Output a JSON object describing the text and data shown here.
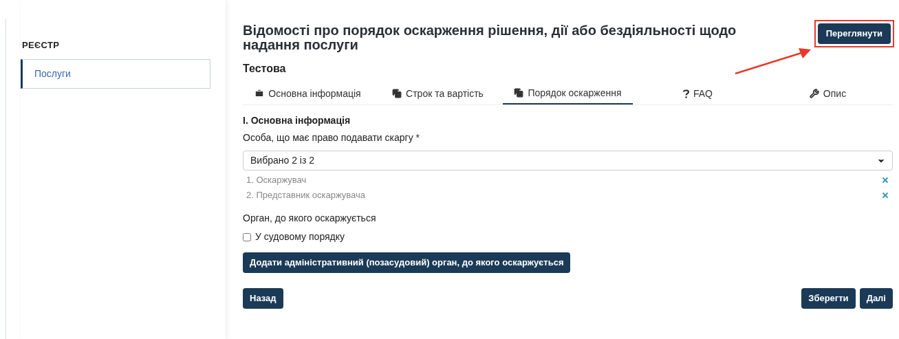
{
  "sidebar": {
    "heading": "РЕЄСТР",
    "items": [
      {
        "label": "Послуги",
        "selected": true
      }
    ]
  },
  "page": {
    "title": "Відомості про порядок оскарження рішення, дії або бездіяльності щодо надання послуги",
    "subtitle": "Тестова",
    "preview_button": "Переглянути",
    "preview_highlighted": true
  },
  "tabs": [
    {
      "label": "Основна інформація",
      "kind": "general",
      "selected": false
    },
    {
      "label": "Строк та вартість",
      "kind": "terms",
      "selected": false
    },
    {
      "label": "Порядок оскарження",
      "kind": "appeal",
      "selected": true
    },
    {
      "label": "FAQ",
      "kind": "faq",
      "selected": false
    },
    {
      "label": "Опис",
      "kind": "description",
      "selected": false
    }
  ],
  "form": {
    "section_title": "I. Основна інформація",
    "complainant_label": "Особа, що має право подавати скаргу *",
    "select_value": "Вибрано 2 із 2",
    "selected_items": [
      "1. Оскаржувач",
      "2. Представник оскаржувача"
    ],
    "authority_label": "Орган, до якого оскаржується",
    "court_checkbox": {
      "label": "У судовому порядку",
      "checked": false
    },
    "add_button": "Додати адміністративний (позасудовий) орган, до якого оскаржується"
  },
  "footer": {
    "back": "Назад",
    "save": "Зберегти",
    "next": "Далі"
  }
}
